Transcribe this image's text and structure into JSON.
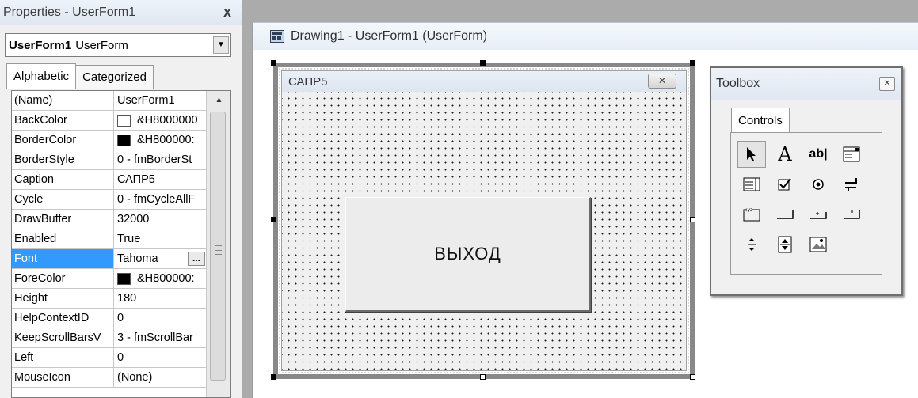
{
  "properties": {
    "title": "Properties - UserForm1",
    "close_label": "x",
    "object_name": "UserForm1",
    "object_type": "UserForm",
    "tabs": [
      "Alphabetic",
      "Categorized"
    ],
    "rows": [
      {
        "name": "(Name)",
        "value": "UserForm1"
      },
      {
        "name": "BackColor",
        "value": "&H8000000"
      },
      {
        "name": "BorderColor",
        "value": "&H800000:"
      },
      {
        "name": "BorderStyle",
        "value": "0 - fmBorderSt"
      },
      {
        "name": "Caption",
        "value": "САПР5"
      },
      {
        "name": "Cycle",
        "value": "0 - fmCycleAllF"
      },
      {
        "name": "DrawBuffer",
        "value": "32000"
      },
      {
        "name": "Enabled",
        "value": "True"
      },
      {
        "name": "Font",
        "value": "Tahoma"
      },
      {
        "name": "ForeColor",
        "value": "&H800000:"
      },
      {
        "name": "Height",
        "value": "180"
      },
      {
        "name": "HelpContextID",
        "value": "0"
      },
      {
        "name": "KeepScrollBarsV",
        "value": "3 - fmScrollBar"
      },
      {
        "name": "Left",
        "value": "0"
      },
      {
        "name": "MouseIcon",
        "value": "(None)"
      }
    ],
    "selected_row": "Font",
    "ellipsis_label": "..."
  },
  "designer": {
    "title": "Drawing1 - UserForm1 (UserForm)",
    "form_caption": "САПР5",
    "close_glyph": "✕",
    "button_label": "ВЫХОД"
  },
  "toolbox": {
    "title": "Toolbox",
    "close_glyph": "✕",
    "tab_label": "Controls",
    "label_tool_glyph": "A",
    "textbox_tool_glyph": "ab|"
  }
}
